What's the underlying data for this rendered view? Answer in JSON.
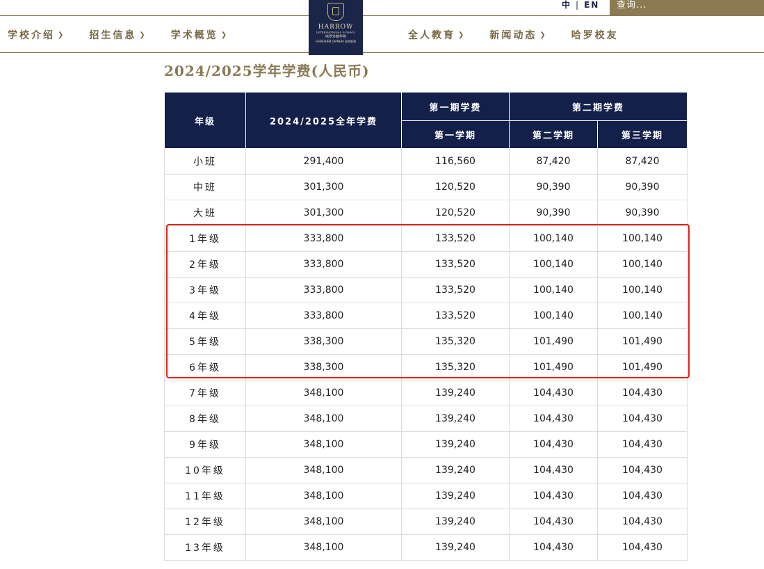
{
  "header": {
    "lang_zh": "中",
    "lang_sep": "|",
    "lang_en": "EN",
    "search_placeholder": "查询...",
    "nav_left": [
      {
        "label": "学校介绍"
      },
      {
        "label": "招生信息"
      },
      {
        "label": "学术概览"
      }
    ],
    "nav_right": [
      {
        "label": "全人教育"
      },
      {
        "label": "新闻动态"
      },
      {
        "label": "哈罗校友"
      }
    ],
    "logo": {
      "line1": "HARROW",
      "line2": "INTERNATIONAL SCHOOL",
      "line3": "哈罗外籍学校",
      "line4": "SHENZHEN QIANHAI 深圳前海"
    },
    "colors": {
      "gold": "#8d7a52",
      "navy": "#1b2548"
    }
  },
  "page_title": "2024/2025学年学费(人民币)",
  "table": {
    "headers": {
      "grade": "年级",
      "annual": "2024/2025全年学费",
      "term1_group": "第一期学费",
      "term2_group": "第二期学费",
      "term1": "第一学期",
      "term2": "第二学期",
      "term3": "第三学期"
    },
    "rows": [
      {
        "grade": "小班",
        "annual": "291,400",
        "t1": "116,560",
        "t2": "87,420",
        "t3": "87,420"
      },
      {
        "grade": "中班",
        "annual": "301,300",
        "t1": "120,520",
        "t2": "90,390",
        "t3": "90,390"
      },
      {
        "grade": "大班",
        "annual": "301,300",
        "t1": "120,520",
        "t2": "90,390",
        "t3": "90,390"
      },
      {
        "grade": "1年级",
        "annual": "333,800",
        "t1": "133,520",
        "t2": "100,140",
        "t3": "100,140"
      },
      {
        "grade": "2年级",
        "annual": "333,800",
        "t1": "133,520",
        "t2": "100,140",
        "t3": "100,140"
      },
      {
        "grade": "3年级",
        "annual": "333,800",
        "t1": "133,520",
        "t2": "100,140",
        "t3": "100,140"
      },
      {
        "grade": "4年级",
        "annual": "333,800",
        "t1": "133,520",
        "t2": "100,140",
        "t3": "100,140"
      },
      {
        "grade": "5年级",
        "annual": "338,300",
        "t1": "135,320",
        "t2": "101,490",
        "t3": "101,490"
      },
      {
        "grade": "6年级",
        "annual": "338,300",
        "t1": "135,320",
        "t2": "101,490",
        "t3": "101,490"
      },
      {
        "grade": "7年级",
        "annual": "348,100",
        "t1": "139,240",
        "t2": "104,430",
        "t3": "104,430"
      },
      {
        "grade": "8年级",
        "annual": "348,100",
        "t1": "139,240",
        "t2": "104,430",
        "t3": "104,430"
      },
      {
        "grade": "9年级",
        "annual": "348,100",
        "t1": "139,240",
        "t2": "104,430",
        "t3": "104,430"
      },
      {
        "grade": "10年级",
        "annual": "348,100",
        "t1": "139,240",
        "t2": "104,430",
        "t3": "104,430"
      },
      {
        "grade": "11年级",
        "annual": "348,100",
        "t1": "139,240",
        "t2": "104,430",
        "t3": "104,430"
      },
      {
        "grade": "12年级",
        "annual": "348,100",
        "t1": "139,240",
        "t2": "104,430",
        "t3": "104,430"
      },
      {
        "grade": "13年级",
        "annual": "348,100",
        "t1": "139,240",
        "t2": "104,430",
        "t3": "104,430"
      }
    ],
    "highlight": {
      "from_grade": "1年级",
      "to_grade": "6年级",
      "color": "#e2231a"
    }
  }
}
